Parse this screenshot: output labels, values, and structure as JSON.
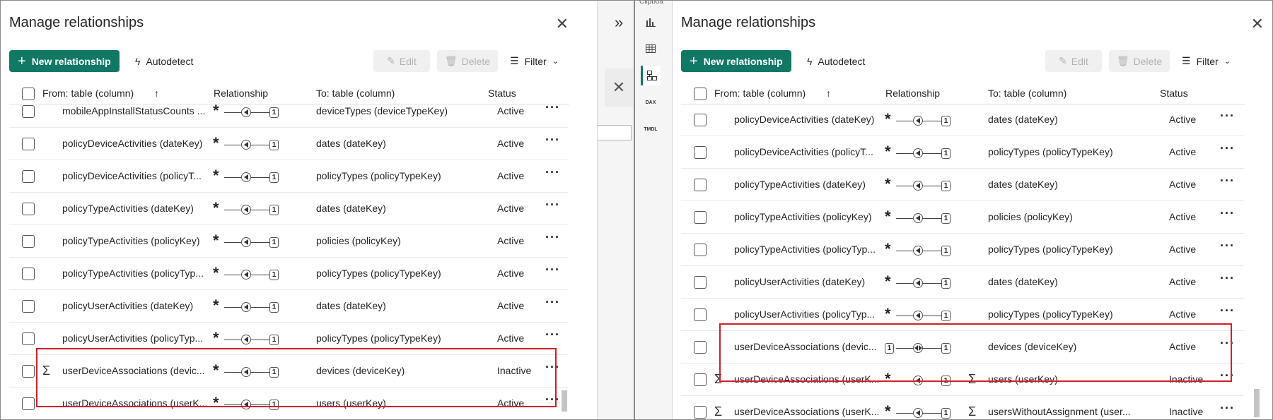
{
  "dialog_title": "Manage relationships",
  "toolbar": {
    "new_relationship": "New relationship",
    "autodetect": "Autodetect",
    "edit": "Edit",
    "delete": "Delete",
    "filter": "Filter"
  },
  "columns": {
    "from": "From: table (column)",
    "relationship": "Relationship",
    "to": "To: table (column)",
    "status": "Status"
  },
  "middle": {
    "clipboard_label": "Clipboa",
    "dax_label": "DAX",
    "tmdl_label": "TMDL"
  },
  "left_rows": [
    {
      "from": "mobileAppInstallStatusCounts ...",
      "to": "deviceTypes (deviceTypeKey)",
      "status": "Active",
      "rel": "many-one",
      "sigma_from": false,
      "sigma_to": false
    },
    {
      "from": "policyDeviceActivities (dateKey)",
      "to": "dates (dateKey)",
      "status": "Active",
      "rel": "many-one",
      "sigma_from": false,
      "sigma_to": false
    },
    {
      "from": "policyDeviceActivities (policyT...",
      "to": "policyTypes (policyTypeKey)",
      "status": "Active",
      "rel": "many-one",
      "sigma_from": false,
      "sigma_to": false
    },
    {
      "from": "policyTypeActivities (dateKey)",
      "to": "dates (dateKey)",
      "status": "Active",
      "rel": "many-one",
      "sigma_from": false,
      "sigma_to": false
    },
    {
      "from": "policyTypeActivities (policyKey)",
      "to": "policies (policyKey)",
      "status": "Active",
      "rel": "many-one",
      "sigma_from": false,
      "sigma_to": false
    },
    {
      "from": "policyTypeActivities (policyTyp...",
      "to": "policyTypes (policyTypeKey)",
      "status": "Active",
      "rel": "many-one",
      "sigma_from": false,
      "sigma_to": false
    },
    {
      "from": "policyUserActivities (dateKey)",
      "to": "dates (dateKey)",
      "status": "Active",
      "rel": "many-one",
      "sigma_from": false,
      "sigma_to": false
    },
    {
      "from": "policyUserActivities (policyTyp...",
      "to": "policyTypes (policyTypeKey)",
      "status": "Active",
      "rel": "many-one",
      "sigma_from": false,
      "sigma_to": false
    },
    {
      "from": "userDeviceAssociations (devic...",
      "to": "devices (deviceKey)",
      "status": "Inactive",
      "rel": "many-one",
      "sigma_from": true,
      "sigma_to": false
    },
    {
      "from": "userDeviceAssociations (userK...",
      "to": "users (userKey)",
      "status": "Active",
      "rel": "many-one",
      "sigma_from": false,
      "sigma_to": false
    }
  ],
  "right_rows": [
    {
      "from": "policyDeviceActivities (dateKey)",
      "to": "dates (dateKey)",
      "status": "Active",
      "rel": "many-one",
      "sigma_from": false,
      "sigma_to": false
    },
    {
      "from": "policyDeviceActivities (policyT...",
      "to": "policyTypes (policyTypeKey)",
      "status": "Active",
      "rel": "many-one",
      "sigma_from": false,
      "sigma_to": false
    },
    {
      "from": "policyTypeActivities (dateKey)",
      "to": "dates (dateKey)",
      "status": "Active",
      "rel": "many-one",
      "sigma_from": false,
      "sigma_to": false
    },
    {
      "from": "policyTypeActivities (policyKey)",
      "to": "policies (policyKey)",
      "status": "Active",
      "rel": "many-one",
      "sigma_from": false,
      "sigma_to": false
    },
    {
      "from": "policyTypeActivities (policyTyp...",
      "to": "policyTypes (policyTypeKey)",
      "status": "Active",
      "rel": "many-one",
      "sigma_from": false,
      "sigma_to": false
    },
    {
      "from": "policyUserActivities (dateKey)",
      "to": "dates (dateKey)",
      "status": "Active",
      "rel": "many-one",
      "sigma_from": false,
      "sigma_to": false
    },
    {
      "from": "policyUserActivities (policyTyp...",
      "to": "policyTypes (policyTypeKey)",
      "status": "Active",
      "rel": "many-one",
      "sigma_from": false,
      "sigma_to": false
    },
    {
      "from": "userDeviceAssociations (devic...",
      "to": "devices (deviceKey)",
      "status": "Active",
      "rel": "one-one",
      "sigma_from": false,
      "sigma_to": false
    },
    {
      "from": "userDeviceAssociations (userK...",
      "to": "users (userKey)",
      "status": "Inactive",
      "rel": "many-one",
      "sigma_from": true,
      "sigma_to": true
    },
    {
      "from": "userDeviceAssociations (userK...",
      "to": "usersWithoutAssignment (user...",
      "status": "Inactive",
      "rel": "many-one",
      "sigma_from": true,
      "sigma_to": true
    }
  ],
  "colors": {
    "primary": "#117865",
    "highlight": "#d0202a"
  }
}
